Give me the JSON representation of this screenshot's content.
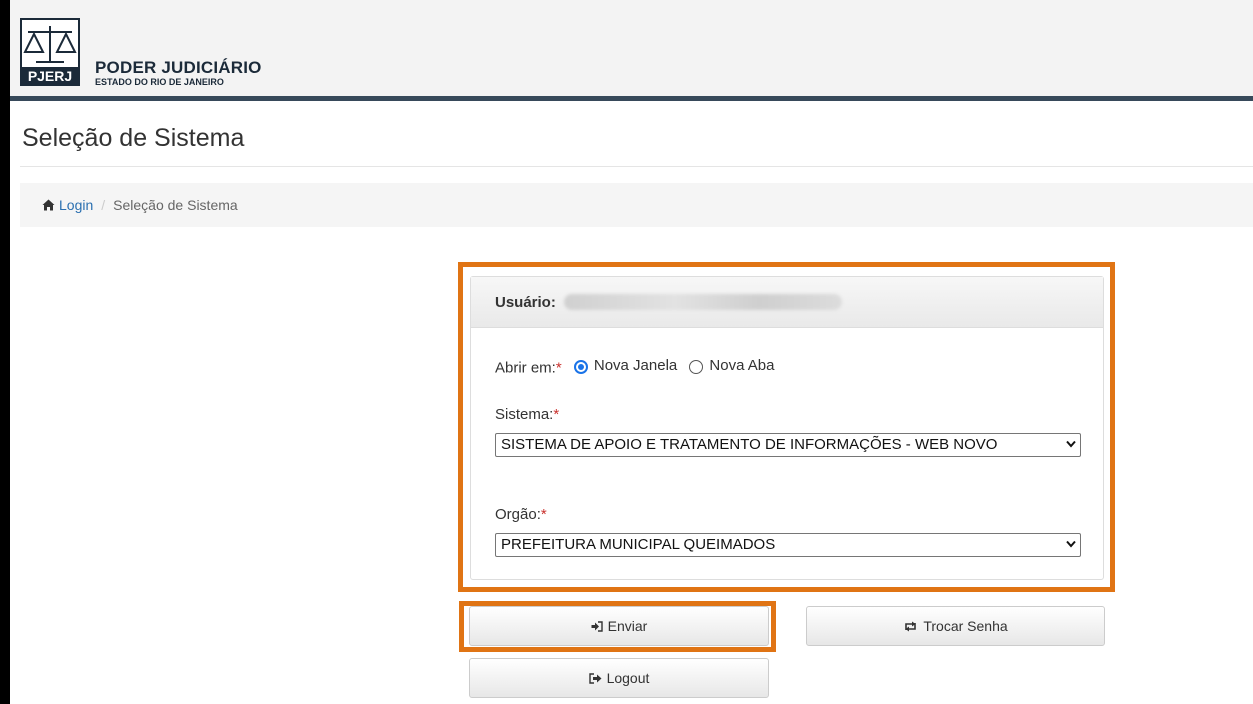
{
  "header": {
    "logo_text": "PJERJ",
    "title": "PODER JUDICIÁRIO",
    "subtitle": "ESTADO DO RIO DE JANEIRO"
  },
  "page": {
    "title": "Seleção de Sistema"
  },
  "breadcrumb": {
    "home_label": "Login",
    "separator": "/",
    "current": "Seleção de Sistema"
  },
  "panel": {
    "user_label": "Usuário:",
    "open_in_label": "Abrir em:",
    "required_mark": "*",
    "radio_new_window": "Nova Janela",
    "radio_new_tab": "Nova Aba",
    "selected_open_in": "Nova Janela",
    "system_label": "Sistema:",
    "system_value": "SISTEMA DE APOIO E TRATAMENTO DE INFORMAÇÕES - WEB NOVO",
    "organ_label": "Orgão:",
    "organ_value": "PREFEITURA MUNICIPAL QUEIMADOS"
  },
  "buttons": {
    "send": "Enviar",
    "change_password": "Trocar Senha",
    "logout": "Logout"
  },
  "colors": {
    "header_bar": "#37495a",
    "highlight": "#e07414",
    "link": "#2a6fb0",
    "radio_accent": "#1a73e8"
  }
}
